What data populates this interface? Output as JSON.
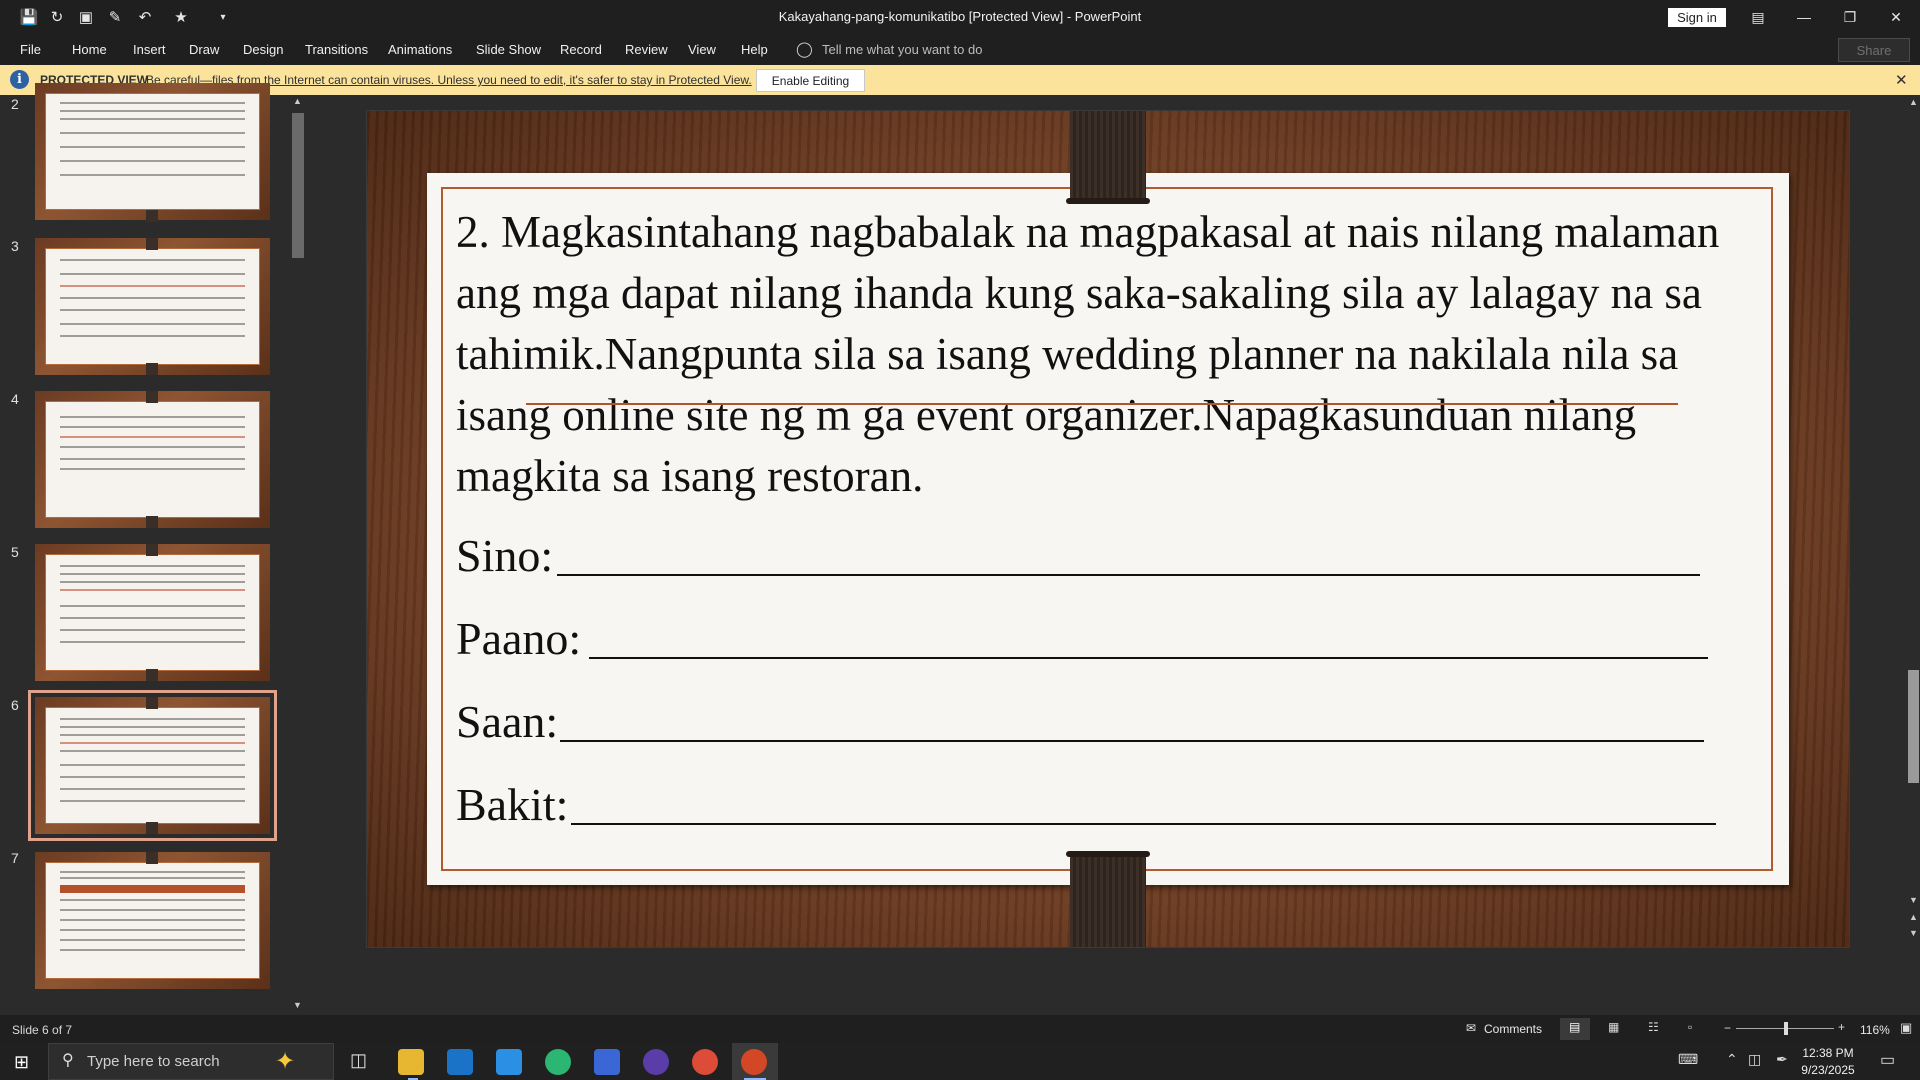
{
  "window": {
    "title": "Kakayahang-pang-komunikatibo [Protected View]  -  PowerPoint",
    "signin_label": "Sign in"
  },
  "ribbon": {
    "file": "File",
    "tabs": [
      "Home",
      "Insert",
      "Draw",
      "Design",
      "Transitions",
      "Animations",
      "Slide Show",
      "Record",
      "Review",
      "View",
      "Help"
    ],
    "tellme_placeholder": "Tell me what you want to do",
    "share_label": "Share"
  },
  "protected_view": {
    "label": "PROTECTED VIEW",
    "message": "Be careful—files from the Internet can contain viruses. Unless you need to edit, it's safer to stay in Protected View.",
    "button": "Enable Editing"
  },
  "thumbnails": {
    "numbers": [
      "2",
      "3",
      "4",
      "5",
      "6",
      "7"
    ],
    "selected": 6
  },
  "slide": {
    "body": "2. Magkasintahang nagbabalak na magpakasal at nais nilang malaman ang mga dapat nilang ihanda kung saka-sakaling sila ay lalagay na sa tahimik.Nangpunta sila sa isang wedding planner na nakilala nila sa isang online site ng m ga event organizer.Napagkasunduan nilang magkita sa isang restoran.",
    "questions": [
      "Sino:",
      "Paano:",
      "Saan:",
      "Bakit:"
    ]
  },
  "status": {
    "slide_count": "Slide 6 of 7",
    "comments": "Comments",
    "zoom": "116%"
  },
  "taskbar": {
    "search_placeholder": "Type here to search",
    "time": "12:38 PM",
    "date": "9/23/2025"
  },
  "colors": {
    "accent_wood": "#6e3d22",
    "pv_bar": "#fbe39c",
    "card_border": "#b05c2c"
  }
}
